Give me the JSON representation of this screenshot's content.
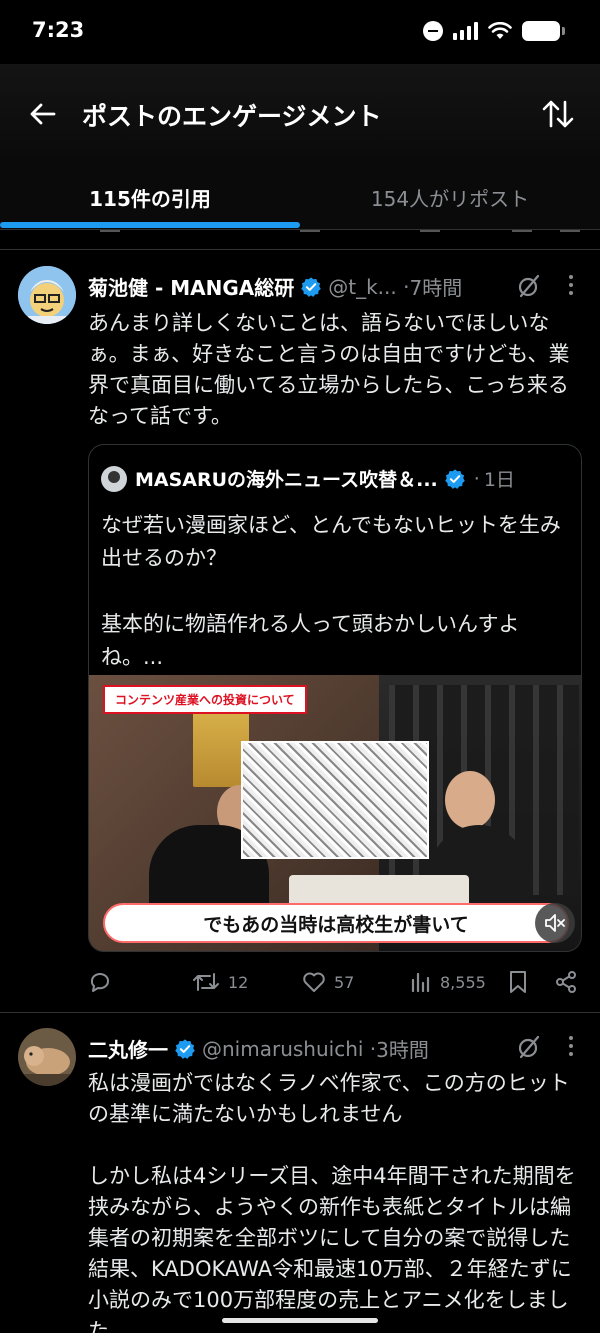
{
  "status_bar": {
    "time": "7:23"
  },
  "header": {
    "title": "ポストのエンゲージメント"
  },
  "tabs": [
    {
      "label": "115件の引用"
    },
    {
      "label": "154人がリポスト"
    }
  ],
  "posts": [
    {
      "name": "菊池健 - MANGA総研",
      "handle": "@t_k...",
      "time": "7時間",
      "text": "あんまり詳しくないことは、語らないでほしいなぁ。まぁ、好きなこと言うのは自由ですけども、業界で真面目に働いてる立場からしたら、こっち来るなって話です。",
      "quote": {
        "name": "MASARUの海外ニュース吹替＆...",
        "time": "1日",
        "text": "なぜ若い漫画家ほど、とんでもないヒットを生み出せるのか？\n\n基本的に物語作れる人って頭おかしいんすよね。...",
        "video_label": "コンテンツ産業への投資について",
        "video_caption": "でもあの当時は高校生が書いて"
      },
      "actions": {
        "replies": "",
        "reposts": "12",
        "likes": "57",
        "views": "8,555"
      }
    },
    {
      "name": "二丸修一",
      "handle": "@nimarushuichi",
      "time": "3時間",
      "text": "私は漫画がではなくラノベ作家で、この方のヒットの基準に満たないかもしれません\n\nしかし私は4シリーズ目、途中4年間干された期間を挟みながら、ようやくの新作も表紙とタイトルは編集者の初期案を全部ボツにして自分の案で説得した結果、KADOKAWA令和最速10万部、２年経たずに小説のみで100万部程度の売上とアニメ化をしました"
    }
  ],
  "colors": {
    "accent": "#1d9bf0",
    "background": "#000000",
    "muted": "#8b8f94"
  }
}
